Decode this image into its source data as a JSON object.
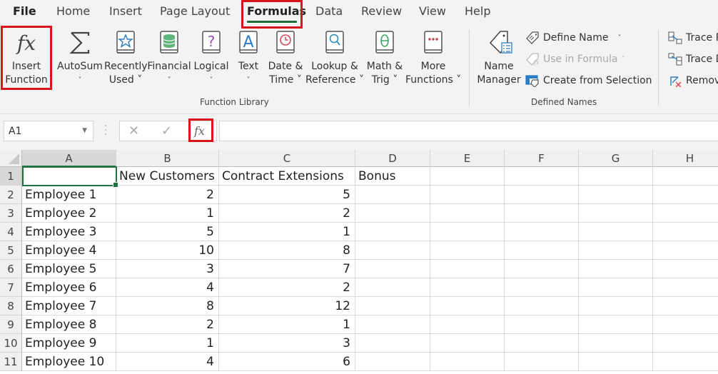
{
  "ribbon": {
    "tabs": [
      {
        "label": "File"
      },
      {
        "label": "Home"
      },
      {
        "label": "Insert"
      },
      {
        "label": "Page Layout"
      },
      {
        "label": "Formulas",
        "active": true
      },
      {
        "label": "Data"
      },
      {
        "label": "Review"
      },
      {
        "label": "View"
      },
      {
        "label": "Help"
      }
    ],
    "function_library": {
      "group_label": "Function Library",
      "buttons": [
        {
          "line1": "Insert",
          "line2": "Function",
          "icon": "fx-icon"
        },
        {
          "line1": "AutoSum",
          "line2": "˅",
          "icon": "sigma-icon"
        },
        {
          "line1": "Recently",
          "line2": "Used ˅",
          "icon": "star-book-icon"
        },
        {
          "line1": "Financial",
          "line2": "˅",
          "icon": "database-book-icon"
        },
        {
          "line1": "Logical",
          "line2": "˅",
          "icon": "question-book-icon"
        },
        {
          "line1": "Text",
          "line2": "˅",
          "icon": "text-book-icon"
        },
        {
          "line1": "Date &",
          "line2": "Time ˅",
          "icon": "clock-book-icon"
        },
        {
          "line1": "Lookup &",
          "line2": "Reference ˅",
          "icon": "magnifier-book-icon"
        },
        {
          "line1": "Math &",
          "line2": "Trig ˅",
          "icon": "theta-book-icon"
        },
        {
          "line1": "More",
          "line2": "Functions ˅",
          "icon": "ellipsis-book-icon"
        }
      ]
    },
    "defined_names": {
      "group_label": "Defined Names",
      "name_manager": {
        "line1": "Name",
        "line2": "Manager"
      },
      "define_name": "Define Name",
      "use_in_formula": "Use in Formula",
      "create_from_selection": "Create from Selection"
    },
    "formula_auditing": {
      "trace_precedents": "Trace P",
      "trace_dependents": "Trace D",
      "remove_arrows": "Remov"
    }
  },
  "formula_bar": {
    "name_box": "A1",
    "cancel_symbol": "✕",
    "enter_symbol": "✓",
    "fx_symbol": "fx",
    "formula": ""
  },
  "sheet": {
    "columns": [
      "A",
      "B",
      "C",
      "D",
      "E",
      "F",
      "G",
      "H"
    ],
    "selected_cell": "A1",
    "rows": [
      {
        "num": "1",
        "cells": [
          "",
          "New Customers",
          "Contract Extensions",
          "Bonus"
        ]
      },
      {
        "num": "2",
        "cells": [
          "Employee 1",
          "2",
          "5",
          ""
        ]
      },
      {
        "num": "3",
        "cells": [
          "Employee 2",
          "1",
          "2",
          ""
        ]
      },
      {
        "num": "4",
        "cells": [
          "Employee 3",
          "5",
          "1",
          ""
        ]
      },
      {
        "num": "5",
        "cells": [
          "Employee 4",
          "10",
          "8",
          ""
        ]
      },
      {
        "num": "6",
        "cells": [
          "Employee 5",
          "3",
          "7",
          ""
        ]
      },
      {
        "num": "7",
        "cells": [
          "Employee 6",
          "4",
          "2",
          ""
        ]
      },
      {
        "num": "8",
        "cells": [
          "Employee 7",
          "8",
          "12",
          ""
        ]
      },
      {
        "num": "9",
        "cells": [
          "Employee 8",
          "2",
          "1",
          ""
        ]
      },
      {
        "num": "10",
        "cells": [
          "Employee 9",
          "1",
          "3",
          ""
        ]
      },
      {
        "num": "11",
        "cells": [
          "Employee 10",
          "4",
          "6",
          ""
        ]
      }
    ]
  },
  "colors": {
    "highlight": "#d9151c",
    "excel_green": "#217346"
  }
}
